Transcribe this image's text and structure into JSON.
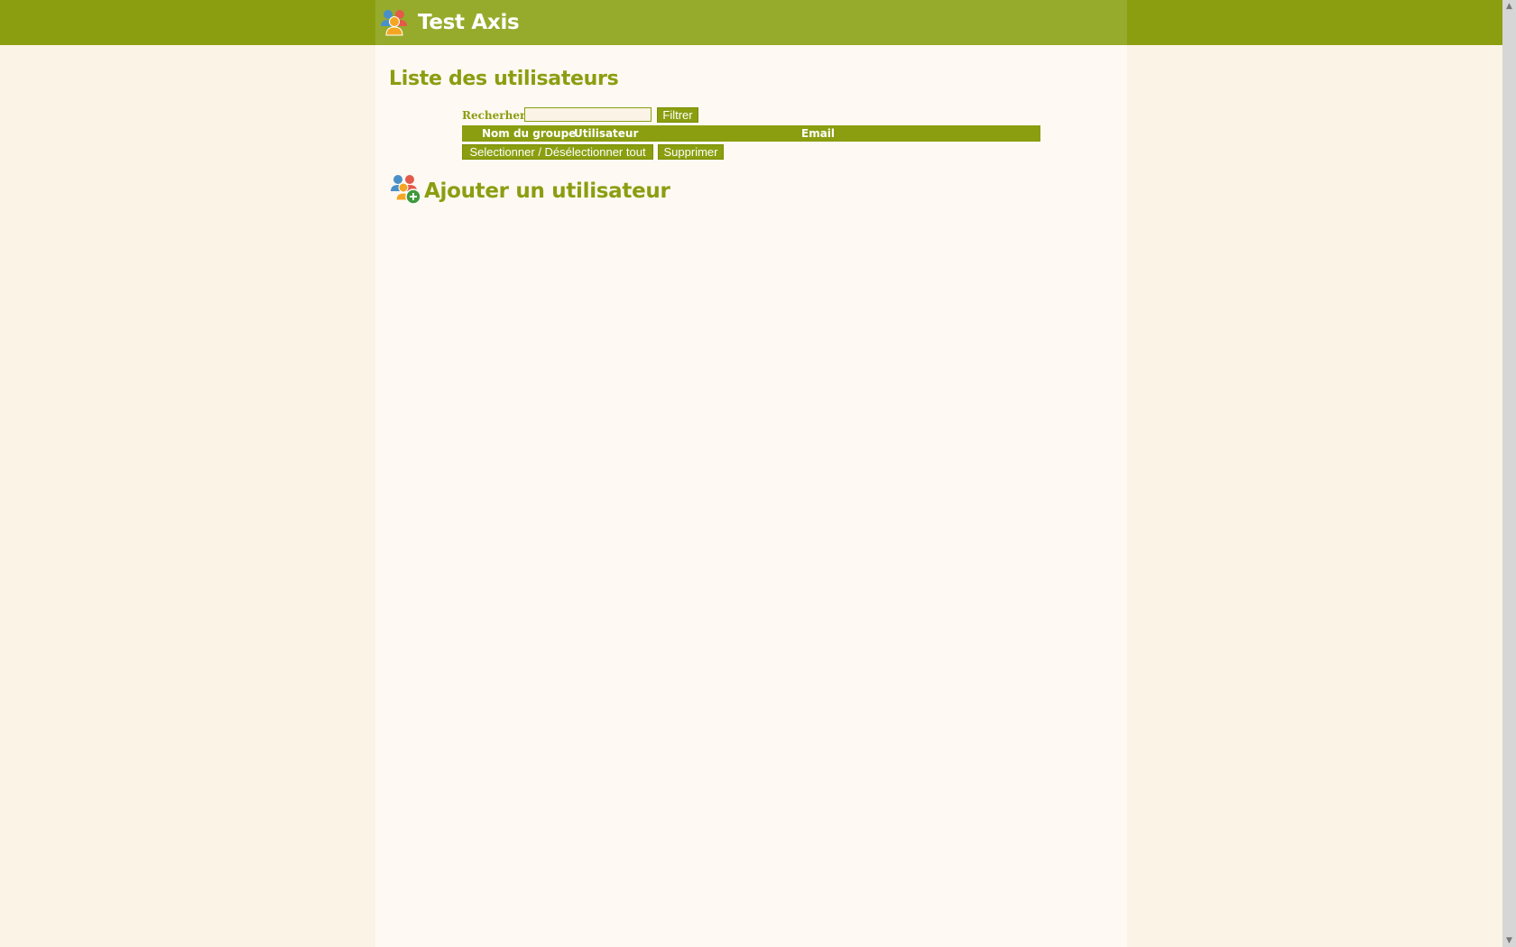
{
  "header": {
    "title": "Test Axis",
    "logo_icon": "users-icon"
  },
  "page": {
    "title": "Liste des utilisateurs"
  },
  "search": {
    "label": "Recherher:",
    "value": "",
    "placeholder": "",
    "filter_label": "Filtrer"
  },
  "table": {
    "columns": [
      "Nom du groupe",
      "Utilisateur",
      "Email"
    ],
    "rows": []
  },
  "actions": {
    "select_all_label": "Selectionner / Désélectionner tout",
    "delete_label": "Supprimer"
  },
  "add_user": {
    "title": "Ajouter un utilisateur",
    "icon": "add-user-icon"
  },
  "colors": {
    "accent": "#8a9e10",
    "header_center": "#96ab2c",
    "background": "#fbf3e6",
    "panel": "#fef9f2"
  }
}
